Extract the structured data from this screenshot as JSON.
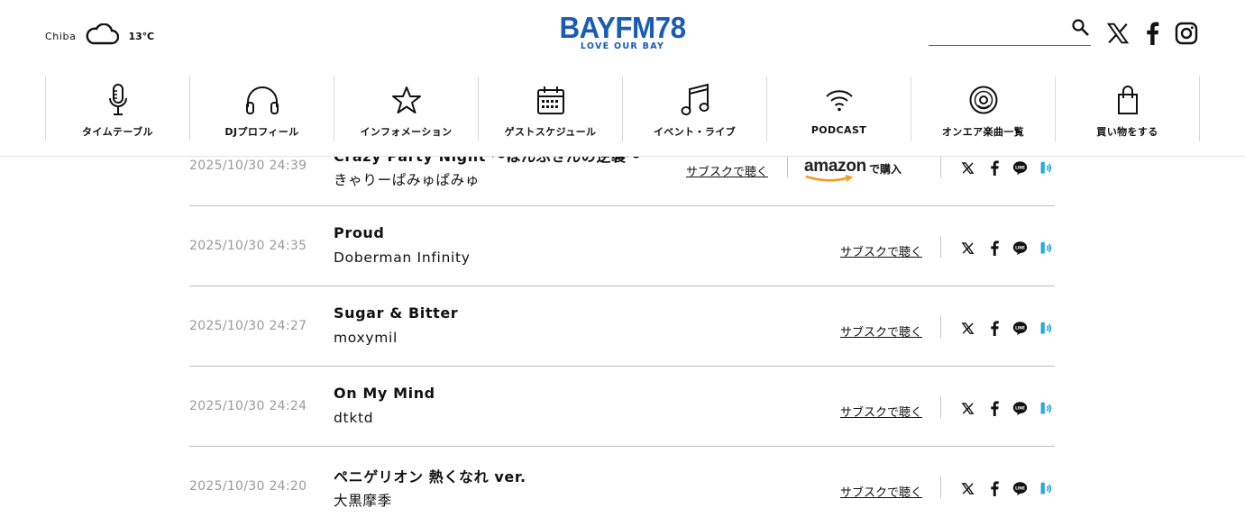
{
  "weather": {
    "city": "Chiba",
    "icon": "cloud-icon",
    "temp": "13℃"
  },
  "logo": {
    "name": "BAYFM78",
    "tagline": "LOVE OUR BAY"
  },
  "search": {
    "placeholder": "",
    "value": ""
  },
  "social_header": [
    "x-icon",
    "facebook-icon",
    "instagram-icon"
  ],
  "nav": [
    {
      "label": "タイムテーブル",
      "icon": "microphone-icon"
    },
    {
      "label": "DJプロフィール",
      "icon": "headphones-icon"
    },
    {
      "label": "インフォメーション",
      "icon": "star-icon"
    },
    {
      "label": "ゲストスケジュール",
      "icon": "calendar-icon"
    },
    {
      "label": "イベント・ライブ",
      "icon": "music-note-icon"
    },
    {
      "label": "PODCAST",
      "icon": "wifi-icon"
    },
    {
      "label": "オンエア楽曲一覧",
      "icon": "disc-icon"
    },
    {
      "label": "買い物をする",
      "icon": "shopping-bag-icon"
    }
  ],
  "songs": [
    {
      "time": "2025/10/30 24:39",
      "title": "Crazy Party Night 〜ぱんぷきんの逆襲〜",
      "artist": "きゃりーぱみゅぱみゅ",
      "subsc": "サブスクで聴く",
      "amazon": "amazon",
      "amazon_buy": "で購入"
    },
    {
      "time": "2025/10/30 24:35",
      "title": "Proud",
      "artist": "Doberman Infinity",
      "subsc": "サブスクで聴く"
    },
    {
      "time": "2025/10/30 24:27",
      "title": "Sugar & Bitter",
      "artist": "moxymil",
      "subsc": "サブスクで聴く"
    },
    {
      "time": "2025/10/30 24:24",
      "title": "On My Mind",
      "artist": "dtktd",
      "subsc": "サブスクで聴く"
    },
    {
      "time": "2025/10/30 24:20",
      "title": "ペニゲリオン 熱くなれ ver.",
      "artist": "大黒摩季",
      "subsc": "サブスクで聴く"
    }
  ],
  "share_icons": [
    "x-icon",
    "facebook-icon",
    "line-icon",
    "radiko-icon"
  ],
  "colors": {
    "brand": "#1a5bb5",
    "radiko": "#2aa7e0",
    "amazon_smile": "#f29a1f"
  }
}
